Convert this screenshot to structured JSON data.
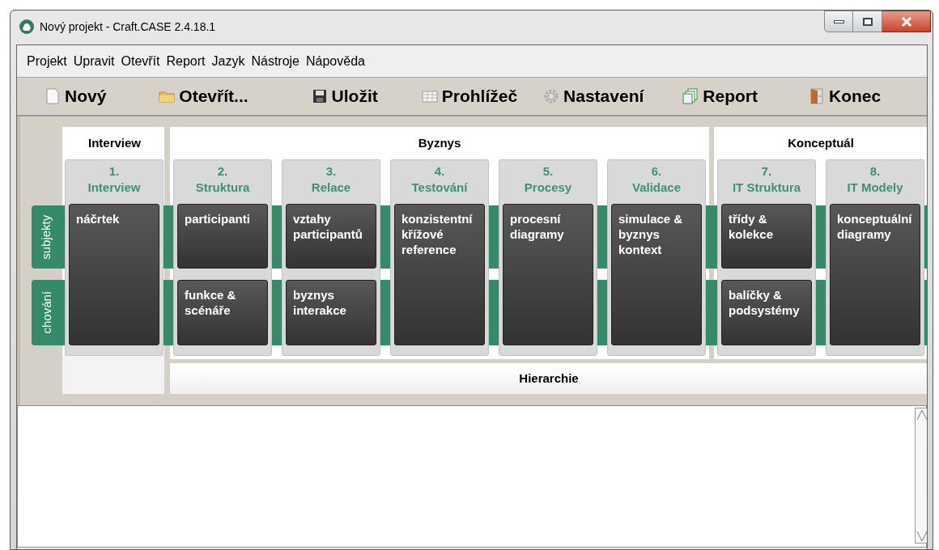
{
  "window": {
    "title": "Nový projekt - Craft.CASE 2.4.18.1"
  },
  "menu": [
    "Projekt",
    "Upravit",
    "Otevřít",
    "Report",
    "Jazyk",
    "Nástroje",
    "Nápověda"
  ],
  "toolbar": [
    "Nový",
    "Otevřít...",
    "Uložit",
    "Prohlížeč",
    "Nastavení",
    "Report",
    "Konec"
  ],
  "lanes": [
    "subjekty",
    "chování"
  ],
  "groups": [
    {
      "label": "Interview",
      "phases": [
        {
          "number": "1.",
          "title": "Interview",
          "cards": [
            {
              "kind": "both",
              "text": "náčrtek"
            }
          ]
        }
      ]
    },
    {
      "label": "Byznys",
      "phases": [
        {
          "number": "2.",
          "title": "Struktura",
          "cards": [
            {
              "kind": "top",
              "text": "participanti"
            },
            {
              "kind": "bottom",
              "text": "funkce & scénáře"
            }
          ]
        },
        {
          "number": "3.",
          "title": "Relace",
          "cards": [
            {
              "kind": "top",
              "text": "vztahy participantů"
            },
            {
              "kind": "bottom",
              "text": "byznys interakce"
            }
          ]
        },
        {
          "number": "4.",
          "title": "Testování",
          "cards": [
            {
              "kind": "both",
              "text": "konzistentní křížové reference"
            }
          ]
        },
        {
          "number": "5.",
          "title": "Procesy",
          "cards": [
            {
              "kind": "both",
              "text": "procesní diagramy"
            }
          ]
        },
        {
          "number": "6.",
          "title": "Validace",
          "cards": [
            {
              "kind": "both",
              "text": "simulace & byznys kontext"
            }
          ]
        }
      ]
    },
    {
      "label": "Konceptuál",
      "phases": [
        {
          "number": "7.",
          "title": "IT Struktura",
          "cards": [
            {
              "kind": "top",
              "text": "třídy & kolekce"
            },
            {
              "kind": "bottom",
              "text": "balíčky & podsystémy"
            }
          ]
        },
        {
          "number": "8.",
          "title": "IT Modely",
          "cards": [
            {
              "kind": "both",
              "text": "konceptuální diagramy"
            }
          ]
        }
      ]
    }
  ],
  "footer": "Hierarchie"
}
